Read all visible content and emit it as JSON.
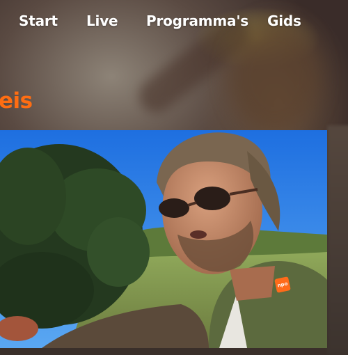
{
  "nav": {
    "items": [
      {
        "label": "Start"
      },
      {
        "label": "Live"
      },
      {
        "label": "Programma's"
      },
      {
        "label": "Gids"
      }
    ]
  },
  "page": {
    "title_fragment": "eis"
  },
  "player": {
    "badge_label": "npo",
    "badge_color": "#ff6b1a"
  },
  "colors": {
    "accent": "#ff6d12",
    "nav_text": "#ffffff"
  }
}
